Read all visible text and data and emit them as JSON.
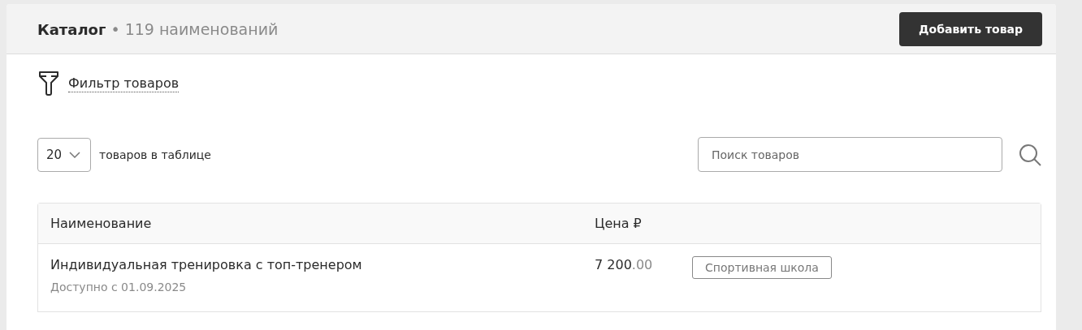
{
  "header": {
    "title": "Каталог",
    "separator": "•",
    "count": "119 наименований",
    "add_button": "Добавить товар"
  },
  "filter_link": "Фильтр товаров",
  "page_size": {
    "value": "20",
    "label": "товаров в таблице"
  },
  "search": {
    "placeholder": "Поиск товаров"
  },
  "table": {
    "columns": [
      "Наименование",
      "Цена ₽"
    ],
    "rows": [
      {
        "name": "Индивидуальная тренировка с топ-тренером",
        "availability": "Доступно с 01.09.2025",
        "price_main": "7 200",
        "price_fraction": ".00",
        "tag": "Спортивная школа"
      }
    ]
  }
}
